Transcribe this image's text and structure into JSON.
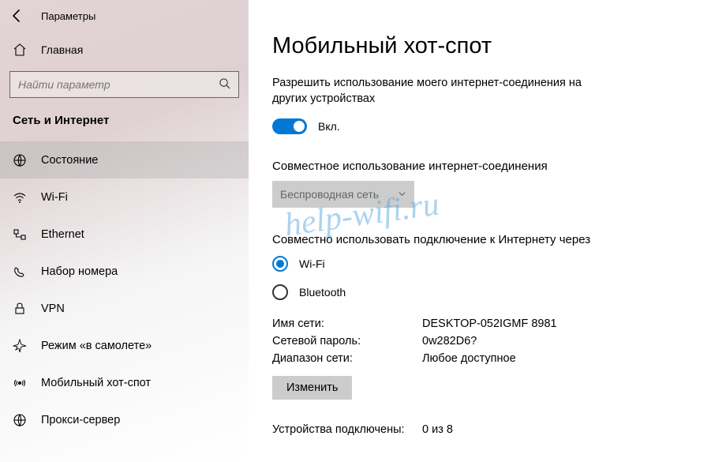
{
  "window": {
    "title": "Параметры"
  },
  "sidebar": {
    "home": "Главная",
    "search_placeholder": "Найти параметр",
    "section": "Сеть и Интернет",
    "items": [
      {
        "label": "Состояние",
        "icon": "status"
      },
      {
        "label": "Wi-Fi",
        "icon": "wifi"
      },
      {
        "label": "Ethernet",
        "icon": "ethernet"
      },
      {
        "label": "Набор номера",
        "icon": "dialup"
      },
      {
        "label": "VPN",
        "icon": "vpn"
      },
      {
        "label": "Режим «в самолете»",
        "icon": "airplane"
      },
      {
        "label": "Мобильный хот-спот",
        "icon": "hotspot"
      },
      {
        "label": "Прокси-сервер",
        "icon": "proxy"
      }
    ]
  },
  "main": {
    "title": "Мобильный хот-спот",
    "share_desc": "Разрешить использование моего интернет-соединения на других устройствах",
    "toggle_label": "Вкл.",
    "share_from_label": "Совместное использование интернет-соединения",
    "share_from_value": "Беспроводная сеть",
    "share_over_label": "Совместно использовать подключение к Интернету через",
    "radio_wifi": "Wi-Fi",
    "radio_bt": "Bluetooth",
    "net_name_label": "Имя сети:",
    "net_name_value": "DESKTOP-052IGMF 8981",
    "net_pw_label": "Сетевой пароль:",
    "net_pw_value": "0w282D6?",
    "net_band_label": "Диапазон сети:",
    "net_band_value": "Любое доступное",
    "edit_btn": "Изменить",
    "devices_label": "Устройства подключены:",
    "devices_value": "0 из 8"
  },
  "watermark": "help-wifi.ru"
}
